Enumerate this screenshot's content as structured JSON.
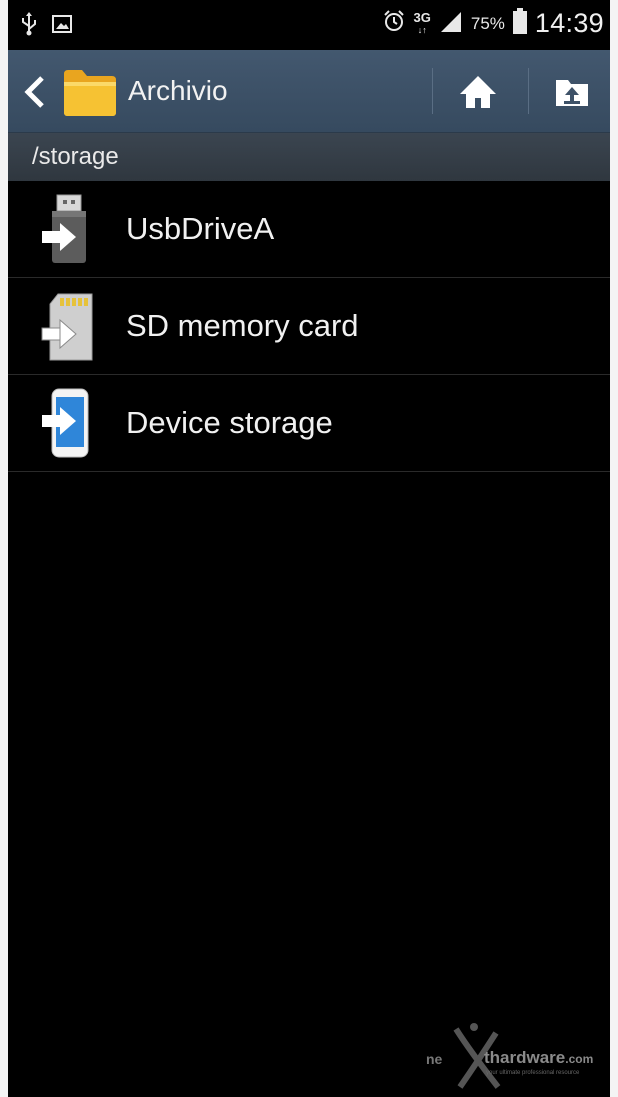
{
  "status_bar": {
    "battery_percent": "75%",
    "time": "14:39",
    "network": "3G",
    "network_arrows": "↓↑",
    "left_icons": [
      "usb-icon",
      "image-icon"
    ],
    "right_icons": [
      "alarm-icon",
      "signal-icon",
      "battery-icon"
    ]
  },
  "action_bar": {
    "title": "Archivio",
    "folder_color": "#f6c233",
    "buttons": [
      "home-icon",
      "folder-up-icon"
    ]
  },
  "path_bar": {
    "path": "/storage"
  },
  "storage_list": {
    "items": [
      {
        "label": "UsbDriveA",
        "icon": "usb-drive-icon"
      },
      {
        "label": "SD memory card",
        "icon": "sd-card-icon"
      },
      {
        "label": "Device storage",
        "icon": "device-storage-icon"
      }
    ]
  },
  "watermark": {
    "prefix": "ne",
    "brand": "thardware",
    "suffix": ".com",
    "tagline": "your ultimate professional resource"
  },
  "colors": {
    "action_bar": "#3e5268",
    "path_bar": "#353d46",
    "background": "#000000",
    "text": "#f1f1f1"
  }
}
